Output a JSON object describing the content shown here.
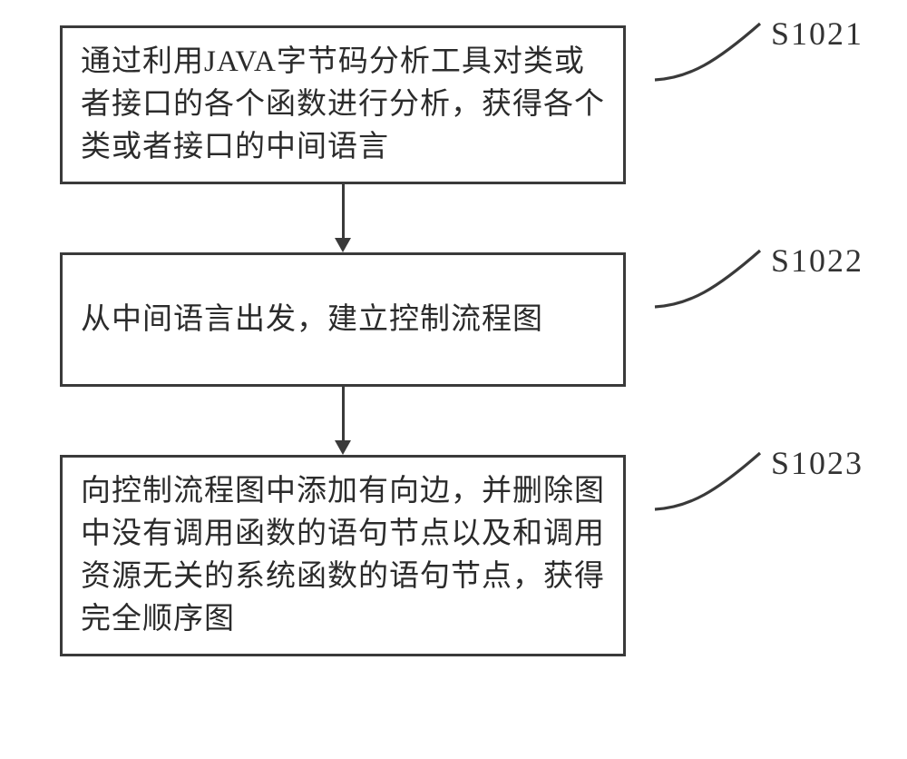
{
  "steps": [
    {
      "id": "S1021",
      "text": "通过利用JAVA字节码分析工具对类或者接口的各个函数进行分析，获得各个类或者接口的中间语言"
    },
    {
      "id": "S1022",
      "text": "从中间语言出发，建立控制流程图"
    },
    {
      "id": "S1023",
      "text": "向控制流程图中添加有向边，并删除图中没有调用函数的语句节点以及和调用资源无关的系统函数的语句节点，获得完全顺序图"
    }
  ]
}
